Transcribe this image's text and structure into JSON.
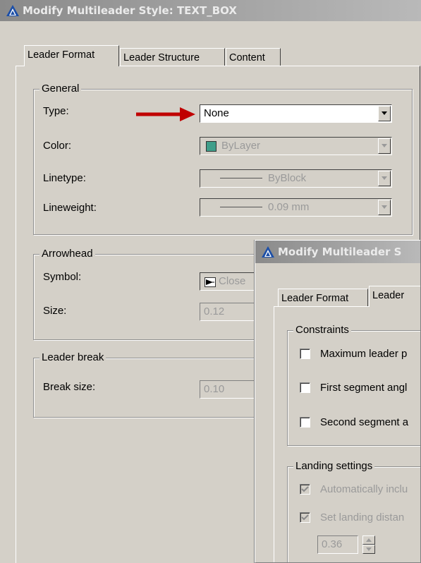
{
  "main_dialog": {
    "title": "Modify Multileader Style: TEXT_BOX",
    "tabs": [
      "Leader Format",
      "Leader Structure",
      "Content"
    ],
    "general": {
      "label": "General",
      "type_label": "Type:",
      "type_value": "None",
      "color_label": "Color:",
      "color_value": "ByLayer",
      "color_swatch": "#3f9e8a",
      "linetype_label": "Linetype:",
      "linetype_value": "ByBlock",
      "lineweight_label": "Lineweight:",
      "lineweight_value": "0.09 mm"
    },
    "arrowhead": {
      "label": "Arrowhead",
      "symbol_label": "Symbol:",
      "symbol_value": "Close",
      "size_label": "Size:",
      "size_value": "0.12"
    },
    "leader_break": {
      "label": "Leader break",
      "break_size_label": "Break size:",
      "break_size_value": "0.10"
    }
  },
  "annotation": {
    "arrow_color": "#c00000"
  },
  "second_dialog": {
    "title": "Modify Multileader S",
    "tabs": [
      "Leader Format",
      "Leader"
    ],
    "constraints": {
      "label": "Constraints",
      "max_leader": "Maximum leader p",
      "first_segment": "First segment angl",
      "second_segment": "Second segment a"
    },
    "landing": {
      "label": "Landing settings",
      "auto_include": "Automatically inclu",
      "set_landing": "Set landing distan",
      "distance_value": "0.36"
    }
  }
}
